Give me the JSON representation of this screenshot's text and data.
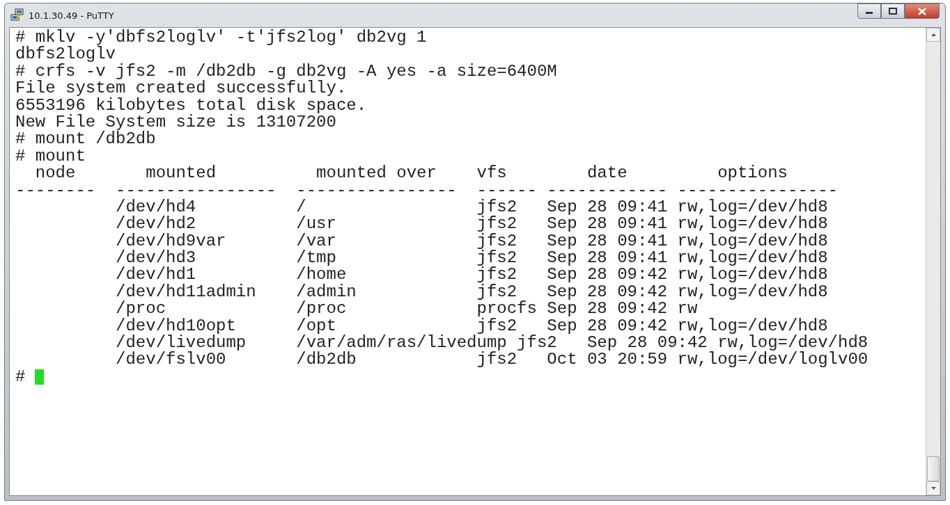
{
  "window": {
    "title": "10.1.30.49 - PuTTY"
  },
  "terminal": {
    "lines": [
      "# mklv -y'dbfs2loglv' -t'jfs2log' db2vg 1",
      "dbfs2loglv",
      "# crfs -v jfs2 -m /db2db -g db2vg -A yes -a size=6400M",
      "File system created successfully.",
      "6553196 kilobytes total disk space.",
      "New File System size is 13107200",
      "# mount /db2db",
      "# mount",
      "  node       mounted          mounted over    vfs        date         options",
      "--------  ----------------  ----------------  ------ ------------ ----------------",
      "          /dev/hd4          /                 jfs2   Sep 28 09:41 rw,log=/dev/hd8",
      "          /dev/hd2          /usr              jfs2   Sep 28 09:41 rw,log=/dev/hd8",
      "          /dev/hd9var       /var              jfs2   Sep 28 09:41 rw,log=/dev/hd8",
      "          /dev/hd3          /tmp              jfs2   Sep 28 09:41 rw,log=/dev/hd8",
      "          /dev/hd1          /home             jfs2   Sep 28 09:42 rw,log=/dev/hd8",
      "          /dev/hd11admin    /admin            jfs2   Sep 28 09:42 rw,log=/dev/hd8",
      "          /proc             /proc             procfs Sep 28 09:42 rw",
      "          /dev/hd10opt      /opt              jfs2   Sep 28 09:42 rw,log=/dev/hd8",
      "          /dev/livedump     /var/adm/ras/livedump jfs2   Sep 28 09:42 rw,log=/dev/hd8",
      "          /dev/fslv00       /db2db            jfs2   Oct 03 20:59 rw,log=/dev/loglv00"
    ],
    "prompt": {
      "text": "#",
      "cursor": true
    }
  }
}
